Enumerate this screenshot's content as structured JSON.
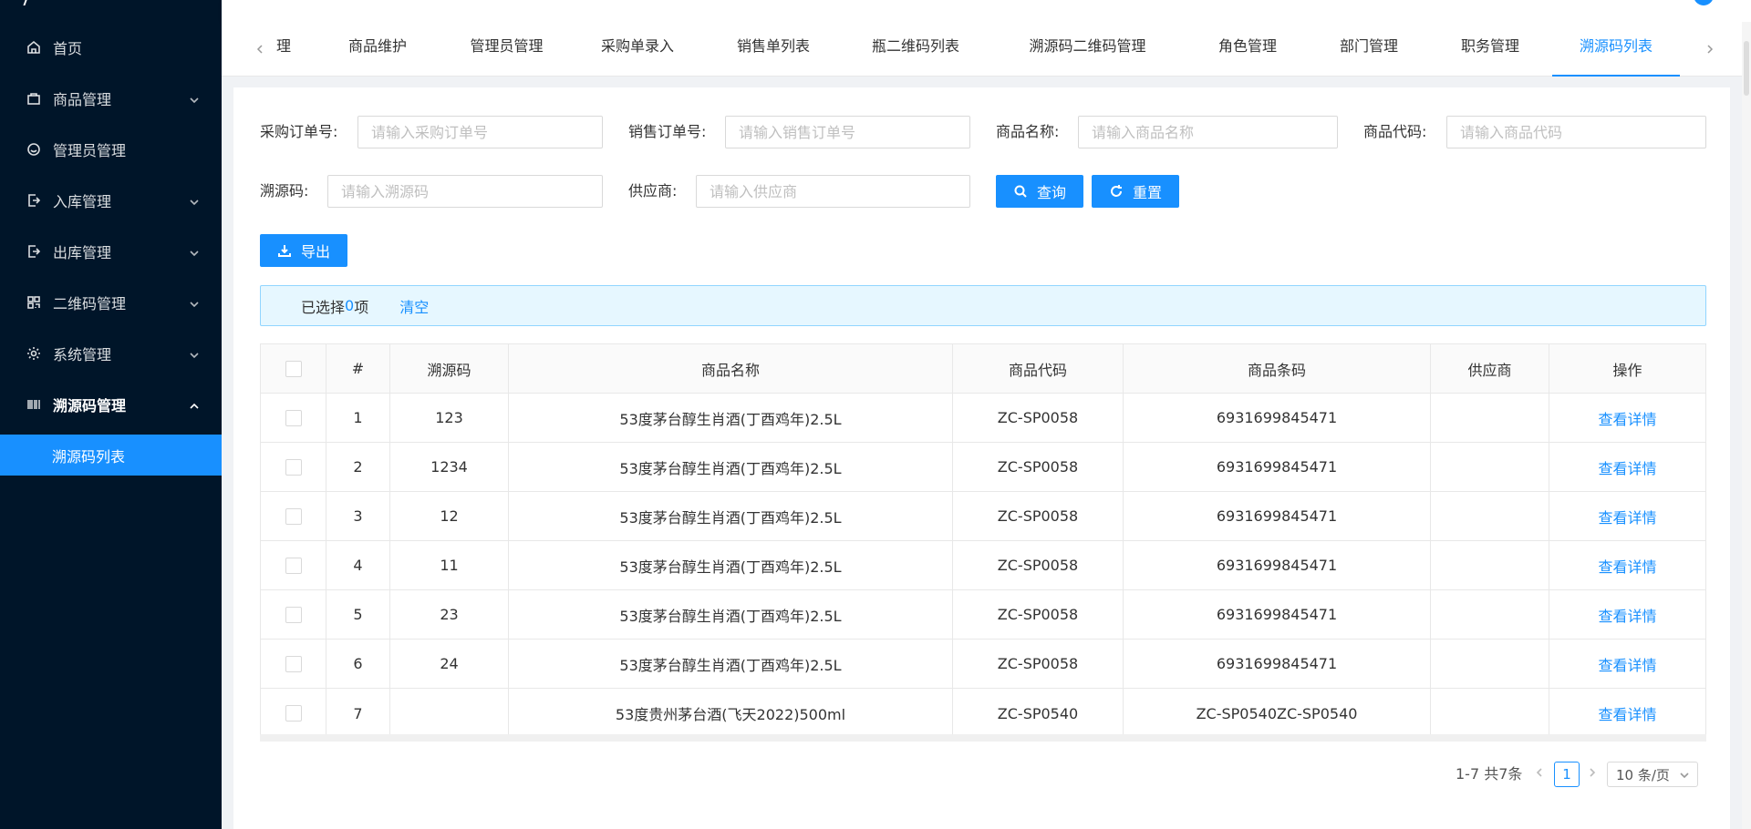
{
  "sidebar": {
    "items": [
      {
        "label": "首页",
        "icon": "home-icon"
      },
      {
        "label": "商品管理",
        "icon": "shopping-bag-icon"
      },
      {
        "label": "管理员管理",
        "icon": "smile-icon"
      },
      {
        "label": "入库管理",
        "icon": "import-icon"
      },
      {
        "label": "出库管理",
        "icon": "export-icon"
      },
      {
        "label": "二维码管理",
        "icon": "qrcode-icon"
      },
      {
        "label": "系统管理",
        "icon": "gear-icon"
      },
      {
        "label": "溯源码管理",
        "icon": "barcode-icon"
      }
    ],
    "sub_item": "溯源码列表"
  },
  "tabs": [
    {
      "label": "理"
    },
    {
      "label": "商品维护"
    },
    {
      "label": "管理员管理"
    },
    {
      "label": "采购单录入"
    },
    {
      "label": "销售单列表"
    },
    {
      "label": "瓶二维码列表"
    },
    {
      "label": "溯源码二维码管理"
    },
    {
      "label": "角色管理"
    },
    {
      "label": "部门管理"
    },
    {
      "label": "职务管理"
    },
    {
      "label": "溯源码列表"
    }
  ],
  "filters": {
    "purchase_order": {
      "label": "采购订单号:",
      "placeholder": "请输入采购订单号",
      "value": ""
    },
    "sales_order": {
      "label": "销售订单号:",
      "placeholder": "请输入销售订单号",
      "value": ""
    },
    "product_name": {
      "label": "商品名称:",
      "placeholder": "请输入商品名称",
      "value": ""
    },
    "product_code": {
      "label": "商品代码:",
      "placeholder": "请输入商品代码",
      "value": ""
    },
    "trace_code": {
      "label": "溯源码:",
      "placeholder": "请输入溯源码",
      "value": ""
    },
    "supplier": {
      "label": "供应商:",
      "placeholder": "请输入供应商",
      "value": ""
    },
    "query_label": "查询",
    "reset_label": "重置"
  },
  "export_label": "导出",
  "selection": {
    "prefix": "已选择 ",
    "count": "0",
    "suffix": "项",
    "clear": "清空"
  },
  "table": {
    "headers": [
      "#",
      "溯源码",
      "商品名称",
      "商品代码",
      "商品条码",
      "供应商",
      "操作"
    ],
    "rows": [
      {
        "no": "1",
        "trace": "123",
        "name": "53度茅台醇生肖酒(丁酉鸡年)2.5L",
        "code": "ZC-SP0058",
        "barcode": "6931699845471",
        "supplier": "",
        "action": "查看详情"
      },
      {
        "no": "2",
        "trace": "1234",
        "name": "53度茅台醇生肖酒(丁酉鸡年)2.5L",
        "code": "ZC-SP0058",
        "barcode": "6931699845471",
        "supplier": "",
        "action": "查看详情"
      },
      {
        "no": "3",
        "trace": "12",
        "name": "53度茅台醇生肖酒(丁酉鸡年)2.5L",
        "code": "ZC-SP0058",
        "barcode": "6931699845471",
        "supplier": "",
        "action": "查看详情"
      },
      {
        "no": "4",
        "trace": "11",
        "name": "53度茅台醇生肖酒(丁酉鸡年)2.5L",
        "code": "ZC-SP0058",
        "barcode": "6931699845471",
        "supplier": "",
        "action": "查看详情"
      },
      {
        "no": "5",
        "trace": "23",
        "name": "53度茅台醇生肖酒(丁酉鸡年)2.5L",
        "code": "ZC-SP0058",
        "barcode": "6931699845471",
        "supplier": "",
        "action": "查看详情"
      },
      {
        "no": "6",
        "trace": "24",
        "name": "53度茅台醇生肖酒(丁酉鸡年)2.5L",
        "code": "ZC-SP0058",
        "barcode": "6931699845471",
        "supplier": "",
        "action": "查看详情"
      },
      {
        "no": "7",
        "trace": "",
        "name": "53度贵州茅台酒(飞天2022)500ml",
        "code": "ZC-SP0540",
        "barcode": "ZC-SP0540ZC-SP0540",
        "supplier": "",
        "action": "查看详情"
      }
    ]
  },
  "pagination": {
    "total": "1-7 共7条",
    "current": "1",
    "page_size": "10 条/页"
  },
  "colors": {
    "primary": "#1890ff",
    "sidebar_bg": "#001529"
  }
}
